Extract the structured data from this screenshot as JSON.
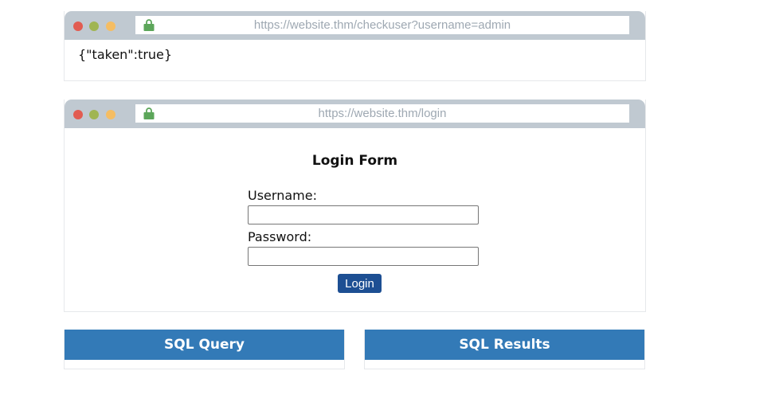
{
  "check_window": {
    "url": "https://website.thm/checkuser?username=admin",
    "response_body": "{\"taken\":true}"
  },
  "login_window": {
    "url": "https://website.thm/login",
    "form_title": "Login Form",
    "username_label": "Username:",
    "username_value": "",
    "password_label": "Password:",
    "password_value": "",
    "login_button_label": "Login"
  },
  "panels": {
    "sql_query_title": "SQL Query",
    "sql_results_title": "SQL Results"
  },
  "colors": {
    "chrome_bar": "#c0c9d1",
    "dot_red": "#e25c51",
    "dot_green": "#a0b552",
    "dot_yellow": "#f5bd63",
    "lock_green": "#5ca65a",
    "login_button": "#1d4f93",
    "panel_header": "#337ab7"
  },
  "icons": {
    "lock": "lock-icon"
  }
}
